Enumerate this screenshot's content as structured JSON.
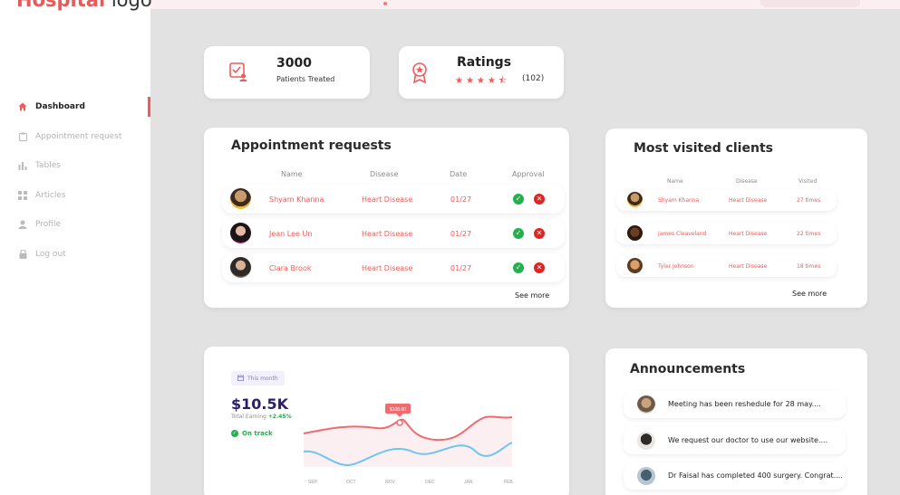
{
  "sidebar": {
    "logo_part1": "Hospital",
    "logo_part2": "logo",
    "items": [
      {
        "label": "Dashboard",
        "icon": "home-icon",
        "active": true
      },
      {
        "label": "Appointment request",
        "icon": "clipboard-icon"
      },
      {
        "label": "Tables",
        "icon": "bar-chart-icon"
      },
      {
        "label": "Articles",
        "icon": "grid-icon"
      },
      {
        "label": "Profile",
        "icon": "user-icon"
      },
      {
        "label": "Log out",
        "icon": "lock-icon"
      }
    ]
  },
  "stats": {
    "patients_value": "3000",
    "patients_label": "Patients Treated",
    "ratings_title": "Ratings",
    "ratings_stars": 4.5,
    "ratings_count": "(102)"
  },
  "appointments": {
    "title": "Appointment requests",
    "columns": [
      "Name",
      "Disease",
      "Date",
      "Approval"
    ],
    "rows": [
      {
        "name": "Shyam Khanna",
        "disease": "Heart Disease",
        "date": "01/27"
      },
      {
        "name": "Jean Lee Un",
        "disease": "Heart Disease",
        "date": "01/27"
      },
      {
        "name": "Clara Brook",
        "disease": "Heart Disease",
        "date": "01/27"
      }
    ],
    "see_more": "See more"
  },
  "clients": {
    "title": "Most visited clients",
    "columns": [
      "Name",
      "Disease",
      "Visited"
    ],
    "rows": [
      {
        "name": "Shyam Khanna",
        "disease": "Heart Disease",
        "visited": "27 times"
      },
      {
        "name": "James Cleaveland",
        "disease": "Heart Disease",
        "visited": "22 times"
      },
      {
        "name": "Tyler Johnson",
        "disease": "Heart Disease",
        "visited": "18 times"
      }
    ],
    "see_more": "See more"
  },
  "earnings": {
    "period": "This month",
    "value": "$10.5K",
    "label": "Total Earning",
    "change": "+2.45%",
    "status": "On track",
    "tooltip": "$108.00",
    "months": [
      "SEP",
      "OCT",
      "NOV",
      "DEC",
      "JAN",
      "FEB"
    ]
  },
  "announcements": {
    "title": "Announcements",
    "items": [
      "Meeting has been reshedule for 28 may....",
      "We request our doctor to use our website....",
      "Dr Faisal has completed 400 surgery. Congrat...."
    ]
  },
  "colors": {
    "accent": "#ef5b5b",
    "approve": "#22b14c",
    "reject": "#e02424",
    "line_red": "#f06b70",
    "line_blue": "#6cc6f0"
  }
}
